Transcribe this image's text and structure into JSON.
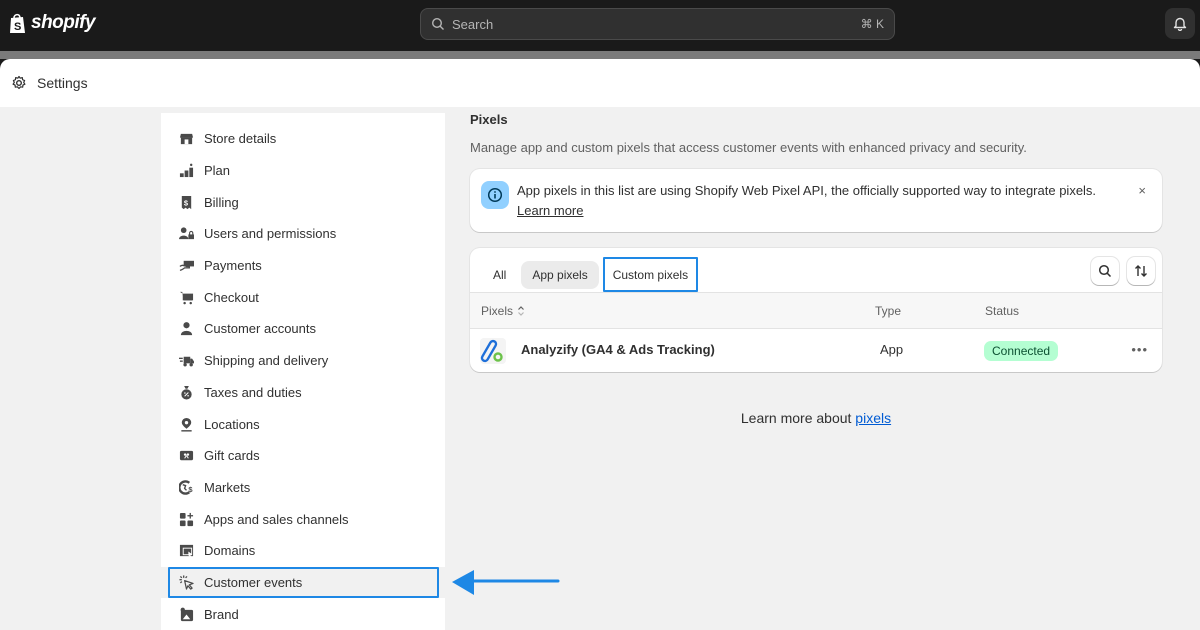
{
  "topbar": {
    "brand": "shopify",
    "search_placeholder": "Search",
    "search_shortcut": "⌘ K",
    "notifications_icon": "bell-icon"
  },
  "header": {
    "title": "Settings",
    "icon": "gear-icon"
  },
  "sidebar": {
    "items": [
      {
        "label": "Store details",
        "icon": "store-icon"
      },
      {
        "label": "Plan",
        "icon": "plan-icon"
      },
      {
        "label": "Billing",
        "icon": "receipt-icon"
      },
      {
        "label": "Users and permissions",
        "icon": "users-lock-icon"
      },
      {
        "label": "Payments",
        "icon": "hand-card-icon"
      },
      {
        "label": "Checkout",
        "icon": "cart-icon"
      },
      {
        "label": "Customer accounts",
        "icon": "person-icon"
      },
      {
        "label": "Shipping and delivery",
        "icon": "truck-icon"
      },
      {
        "label": "Taxes and duties",
        "icon": "tax-bag-icon"
      },
      {
        "label": "Locations",
        "icon": "location-pin-icon"
      },
      {
        "label": "Gift cards",
        "icon": "gift-card-icon"
      },
      {
        "label": "Markets",
        "icon": "globe-dollar-icon"
      },
      {
        "label": "Apps and sales channels",
        "icon": "apps-icon"
      },
      {
        "label": "Domains",
        "icon": "domain-icon"
      },
      {
        "label": "Customer events",
        "icon": "cursor-click-icon",
        "active": true,
        "highlighted": true
      },
      {
        "label": "Brand",
        "icon": "brand-image-icon"
      }
    ]
  },
  "annotation": {
    "arrow_color": "#1e88e5",
    "highlight_color": "#1e88e5"
  },
  "main": {
    "title": "Pixels",
    "description": "Manage app and custom pixels that access customer events with enhanced privacy and security.",
    "banner": {
      "text": "App pixels in this list are using Shopify Web Pixel API, the officially supported way to integrate pixels.",
      "link": "Learn more",
      "close": "×"
    },
    "tabs": [
      {
        "label": "All"
      },
      {
        "label": "App pixels",
        "selected": true
      },
      {
        "label": "Custom pixels",
        "highlighted": true
      }
    ],
    "table": {
      "columns": [
        "Pixels",
        "Type",
        "Status"
      ],
      "rows": [
        {
          "name": "Analyzify (GA4 & Ads Tracking)",
          "type": "App",
          "status": "Connected",
          "actions": "•••"
        }
      ]
    },
    "footer": {
      "text": "Learn more about ",
      "link": "pixels"
    }
  },
  "colors": {
    "accent": "#005bd3",
    "status_connected_bg": "#b4fed2",
    "status_connected_text": "#0c5132",
    "info_bg": "#91d0ff"
  }
}
